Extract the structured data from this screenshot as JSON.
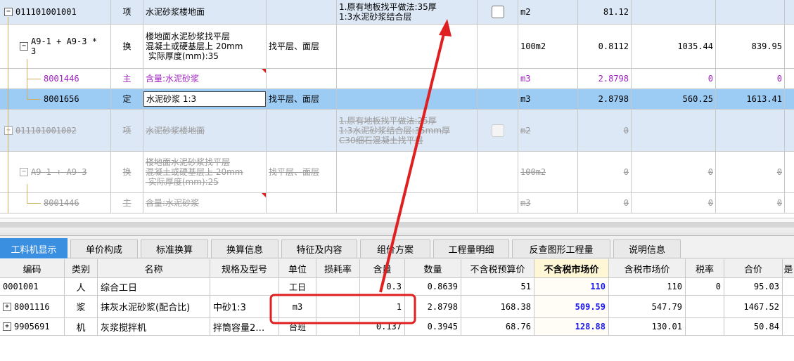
{
  "top_rows": [
    {
      "code": "011101001001",
      "type": "项",
      "name": "水泥砂浆楼地面",
      "feature": "",
      "desc": "1.原有地板找平做法:35厚\n1:3水泥砂浆结合层",
      "unit": "m2",
      "qty": "81.12",
      "price": "",
      "total": "",
      "tree": "−"
    },
    {
      "code": "A9-1 + A9-3 *\n3",
      "type": "换",
      "name": "楼地面水泥砂浆找平层\n混凝土或硬基层上 20mm\n 实际厚度(mm):35",
      "feature": "找平层、面层",
      "desc": "",
      "unit": "100m2",
      "qty": "0.8112",
      "price": "1035.44",
      "total": "839.95",
      "tree": "−"
    },
    {
      "code": "8001446",
      "type": "主",
      "name": "含量:水泥砂浆",
      "feature": "",
      "desc": "",
      "unit": "m3",
      "qty": "2.8798",
      "price": "0",
      "total": "0"
    },
    {
      "code": "8001656",
      "type": "定",
      "name": "水泥砂浆 1:3",
      "feature": "找平层、面层",
      "desc": "",
      "unit": "m3",
      "qty": "2.8798",
      "price": "560.25",
      "total": "1613.41"
    },
    {
      "code": "011101001002",
      "type": "项",
      "name": "水泥砂浆楼地面",
      "feature": "",
      "desc": "1.原有地板找平做法:25厚\n1:3水泥砂浆结合层:35mm厚\nC30细石混凝土找平层",
      "unit": "m2",
      "qty": "0",
      "price": "",
      "total": "",
      "tree": "−"
    },
    {
      "code": "A9-1 + A9-3",
      "type": "换",
      "name": "楼地面水泥砂浆找平层\n混凝土或硬基层上 20mm\n 实际厚度(mm):25",
      "feature": "找平层、面层",
      "desc": "",
      "unit": "100m2",
      "qty": "0",
      "price": "0",
      "total": "0",
      "tree": "−"
    },
    {
      "code": "8001446",
      "type": "主",
      "name": "含量:水泥砂浆",
      "feature": "",
      "desc": "",
      "unit": "m3",
      "qty": "0",
      "price": "0",
      "total": "0"
    }
  ],
  "tabs": [
    "工料机显示",
    "单价构成",
    "标准换算",
    "换算信息",
    "特征及内容",
    "组价方案",
    "工程量明细",
    "反查图形工程量",
    "说明信息"
  ],
  "columns": [
    "编码",
    "类别",
    "名称",
    "规格及型号",
    "单位",
    "损耗率",
    "含量",
    "数量",
    "不含税预算价",
    "不含税市场价",
    "含税市场价",
    "税率",
    "合价",
    "是"
  ],
  "rows": [
    {
      "code": "0001001",
      "cat": "人",
      "name": "综合工日",
      "spec": "",
      "unit": "工日",
      "loss": "",
      "content": "0.3",
      "num": "0.8639",
      "pre": "51",
      "mkt": "110",
      "tmk": "110",
      "tax": "0",
      "sum": "95.03",
      "expand": ""
    },
    {
      "code": "8001116",
      "cat": "浆",
      "name": "抹灰水泥砂浆(配合比)",
      "spec": "中砂1:3",
      "unit": "m3",
      "loss": "",
      "content": "1",
      "num": "2.8798",
      "pre": "168.38",
      "mkt": "509.59",
      "tmk": "547.79",
      "tax": "",
      "sum": "1467.52",
      "expand": "+"
    },
    {
      "code": "9905691",
      "cat": "机",
      "name": "灰浆搅拌机",
      "spec": "拌筒容量2…",
      "unit": "台班",
      "loss": "",
      "content": "0.137",
      "num": "0.3945",
      "pre": "68.76",
      "mkt": "128.88",
      "tmk": "130.01",
      "tax": "",
      "sum": "50.84",
      "expand": "+"
    }
  ],
  "colors": {
    "accent": "#3b8fe0",
    "annotation": "#e02020",
    "selected_row": "#9ccbf3",
    "item_row": "#dde8f6"
  }
}
